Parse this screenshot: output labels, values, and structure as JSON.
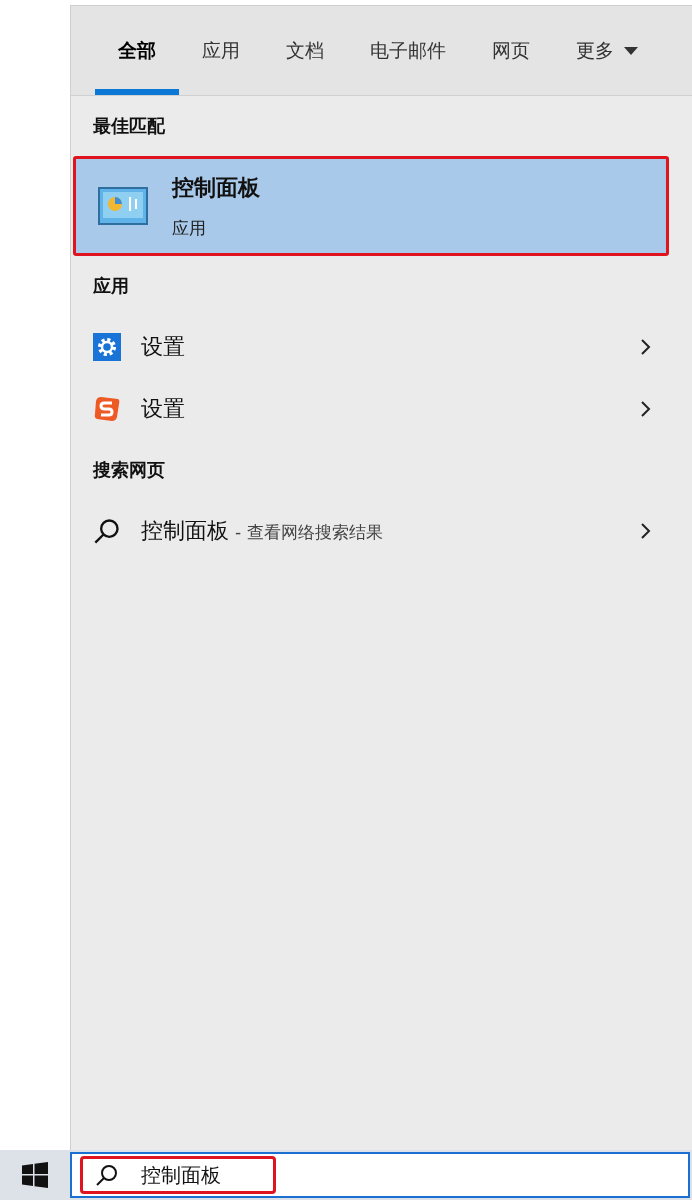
{
  "tabs": [
    {
      "label": "全部",
      "selected": true,
      "kind": "plain"
    },
    {
      "label": "应用",
      "selected": false,
      "kind": "plain"
    },
    {
      "label": "文档",
      "selected": false,
      "kind": "plain"
    },
    {
      "label": "电子邮件",
      "selected": false,
      "kind": "plain"
    },
    {
      "label": "网页",
      "selected": false,
      "kind": "plain"
    },
    {
      "label": "更多",
      "selected": false,
      "kind": "dropdown"
    }
  ],
  "best_match": {
    "header": "最佳匹配",
    "title": "控制面板",
    "subtitle": "应用",
    "selected": true,
    "annotated": true
  },
  "apps": {
    "header": "应用",
    "items": [
      {
        "label": "设置",
        "kind": "gear"
      },
      {
        "label": "设置",
        "kind": "s-logo"
      }
    ]
  },
  "web": {
    "header": "搜索网页",
    "items": [
      {
        "query": "控制面板",
        "note": "- 查看网络搜索结果"
      }
    ]
  },
  "search_box": {
    "value": "控制面板",
    "annotated": true
  }
}
